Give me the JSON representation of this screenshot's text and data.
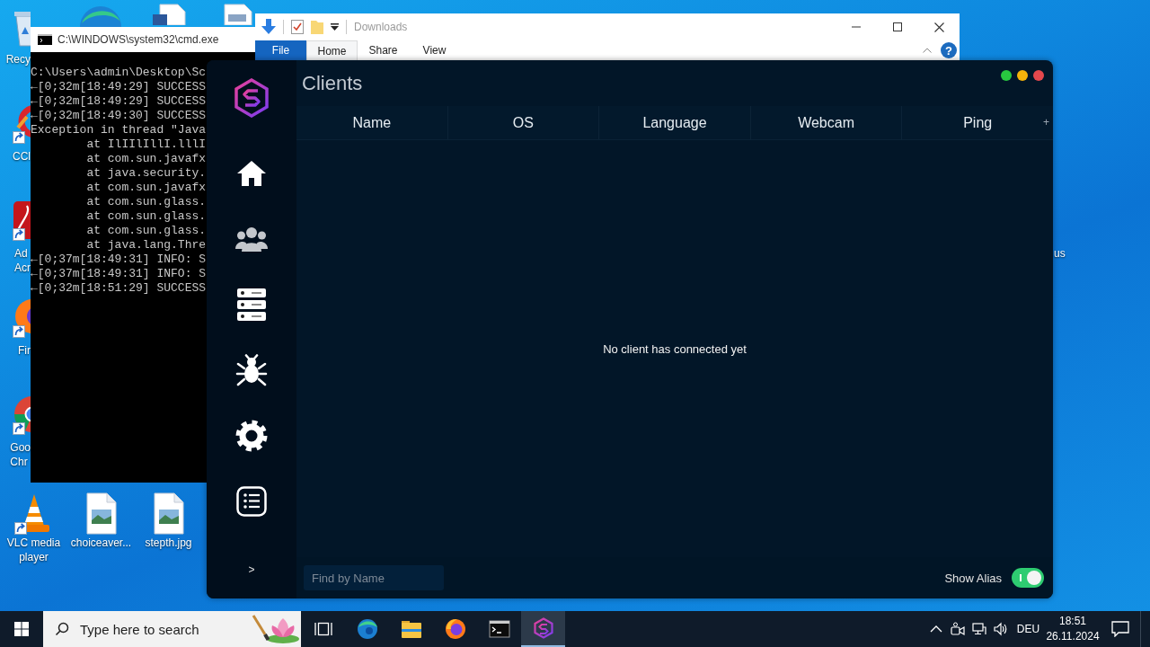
{
  "desktop": {
    "top_icons": [
      {
        "kind": "edge"
      },
      {
        "kind": "word-document"
      },
      {
        "kind": "document"
      }
    ],
    "left_icons": [
      {
        "kind": "recycle-bin",
        "label": "Recy",
        "shortcut": false
      },
      {
        "kind": "ccleaner",
        "label": "CCl",
        "shortcut": true
      },
      {
        "kind": "acrobat",
        "label": "Ad Acr",
        "shortcut": true
      },
      {
        "kind": "firefox",
        "label": "Fir",
        "shortcut": true
      },
      {
        "kind": "chrome",
        "label": "Goo Chr",
        "shortcut": true
      }
    ],
    "bottom_icons": [
      {
        "kind": "vlc",
        "label": "VLC media player",
        "shortcut": true
      },
      {
        "kind": "image-file",
        "label": "choiceaver...",
        "shortcut": false
      },
      {
        "kind": "image-file",
        "label": "stepth.jpg",
        "shortcut": false
      }
    ],
    "right_label": "us"
  },
  "cmd_window": {
    "title": "C:\\WINDOWS\\system32\\cmd.exe",
    "lines": [
      "C:\\Users\\admin\\Desktop\\Sc",
      "←[0;32m[18:49:29] SUCCESS",
      "←[0;32m[18:49:29] SUCCESS",
      "←[0;32m[18:49:30] SUCCESS",
      "Exception in thread \"Java",
      "        at IlIIlIllI.lllI",
      "        at com.sun.javafx",
      "        at java.security.",
      "        at com.sun.javafx",
      "        at com.sun.glass.",
      "        at com.sun.glass.",
      "        at com.sun.glass.",
      "        at java.lang.Thre",
      "←[0;37m[18:49:31] INFO: S",
      "←[0;37m[18:49:31] INFO: S",
      "←[0;32m[18:51:29] SUCCESS"
    ]
  },
  "explorer_window": {
    "title": "Downloads",
    "tabs": [
      {
        "label": "File",
        "kind": "menu",
        "selected": false
      },
      {
        "label": "Home",
        "kind": "tab",
        "selected": true
      },
      {
        "label": "Share",
        "kind": "tab",
        "selected": false
      },
      {
        "label": "View",
        "kind": "tab",
        "selected": false
      }
    ],
    "help_label": "?"
  },
  "app_window": {
    "title": "Clients",
    "window_controls": [
      {
        "color": "#28c840"
      },
      {
        "color": "#f4b30a"
      },
      {
        "color": "#e5484d"
      }
    ],
    "nav": [
      {
        "kind": "home",
        "selected": false
      },
      {
        "kind": "users",
        "selected": true
      },
      {
        "kind": "servers",
        "selected": false
      },
      {
        "kind": "bug",
        "selected": false
      },
      {
        "kind": "settings",
        "selected": false
      },
      {
        "kind": "list",
        "selected": false
      }
    ],
    "expand_label": ">",
    "table": {
      "columns": [
        "Name",
        "OS",
        "Language",
        "Webcam",
        "Ping"
      ],
      "menu_label": "+",
      "empty_message": "No client has connected yet"
    },
    "search": {
      "placeholder": "Find by Name"
    },
    "alias_toggle": {
      "label": "Show Alias",
      "on": true
    }
  },
  "taskbar": {
    "search": {
      "placeholder": "Type here to search"
    },
    "apps": [
      {
        "kind": "edge",
        "selected": false
      },
      {
        "kind": "file-explorer",
        "selected": false
      },
      {
        "kind": "firefox",
        "selected": false
      },
      {
        "kind": "terminal",
        "selected": false
      },
      {
        "kind": "hexagon-app",
        "selected": true
      }
    ],
    "tray": {
      "language": "DEU",
      "time": "18:51",
      "date": "26.11.2024"
    }
  }
}
